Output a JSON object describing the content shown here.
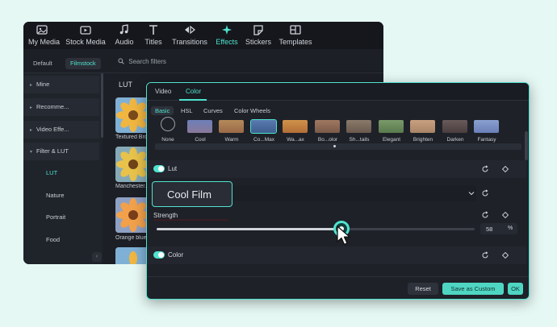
{
  "toolbar": {
    "items": [
      {
        "label": "My Media",
        "icon": "media-icon"
      },
      {
        "label": "Stock Media",
        "icon": "stock-media-icon"
      },
      {
        "label": "Audio",
        "icon": "music-note-icon"
      },
      {
        "label": "Titles",
        "icon": "text-icon"
      },
      {
        "label": "Transitions",
        "icon": "transition-icon"
      },
      {
        "label": "Effects",
        "icon": "effects-sparkle-icon",
        "active": true
      },
      {
        "label": "Stickers",
        "icon": "sticker-icon"
      },
      {
        "label": "Templates",
        "icon": "templates-icon"
      }
    ]
  },
  "filter_bar": {
    "default_label": "Default",
    "filmstock_label": "Filmstock",
    "search_placeholder": "Search filters"
  },
  "sidebar": {
    "items": [
      {
        "label": "Mine"
      },
      {
        "label": "Recomme..."
      },
      {
        "label": "Video Effe..."
      },
      {
        "label": "Filter & LUT"
      }
    ],
    "subitems": [
      {
        "label": "LUT",
        "active": true
      },
      {
        "label": "Nature"
      },
      {
        "label": "Portrait"
      },
      {
        "label": "Food"
      }
    ]
  },
  "content": {
    "section_title": "LUT",
    "thumbnails": [
      {
        "label": "Textured Bro..."
      },
      {
        "label": "Manchester..."
      },
      {
        "label": "Orange blue..."
      }
    ]
  },
  "dialog": {
    "tabs": [
      {
        "label": "Video"
      },
      {
        "label": "Color",
        "active": true
      }
    ],
    "subtabs": [
      {
        "label": "Basic",
        "active": true
      },
      {
        "label": "HSL"
      },
      {
        "label": "Curves"
      },
      {
        "label": "Color Wheels"
      }
    ],
    "presets": [
      {
        "label": "None"
      },
      {
        "label": "Cool"
      },
      {
        "label": "Warm"
      },
      {
        "label": "Co...Max",
        "selected": true
      },
      {
        "label": "Wa...ax"
      },
      {
        "label": "Bo...olor"
      },
      {
        "label": "Sh...tails"
      },
      {
        "label": "Elegant"
      },
      {
        "label": "Brighten"
      },
      {
        "label": "Darken"
      },
      {
        "label": "Fantasy"
      }
    ],
    "lut_label": "Lut",
    "lut_selected": "Cool Film",
    "strength_label": "Strength",
    "strength_value": "58",
    "strength_unit": "%",
    "strength_fraction": 0.58,
    "color_label": "Color",
    "reset_label": "Reset",
    "save_custom_label": "Save as Custom",
    "ok_label": "OK"
  },
  "colors": {
    "accent": "#4fe3d0",
    "panel_bg": "#1e2128",
    "page_bg": "#e6f8f4"
  }
}
